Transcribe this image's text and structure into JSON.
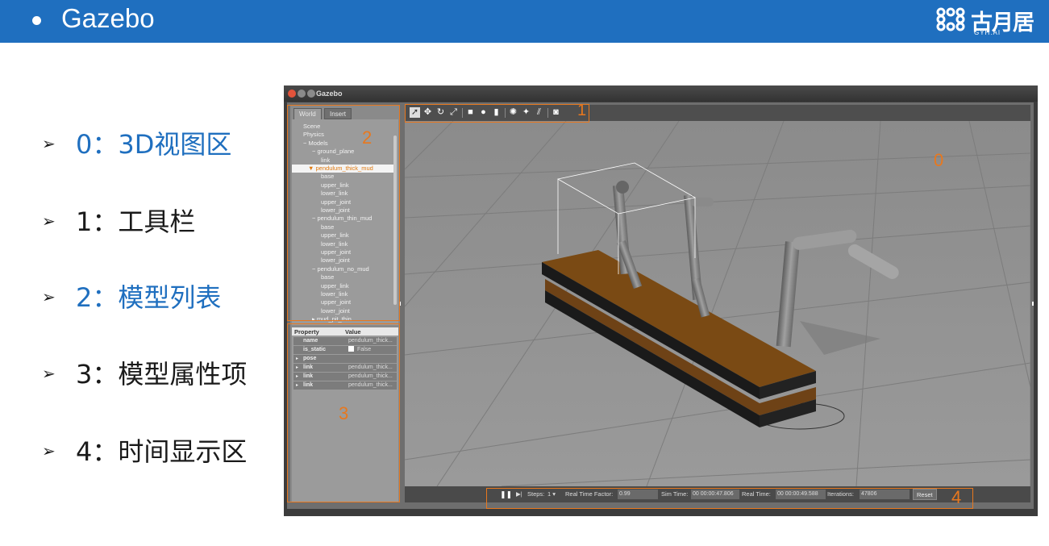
{
  "slide": {
    "title": "Gazebo",
    "logo": {
      "text": "古月居",
      "sub": "GYH.AI"
    },
    "legend": [
      {
        "text": "0：3D视图区",
        "color": "blue"
      },
      {
        "text": "1：工具栏",
        "color": "black"
      },
      {
        "text": "2：模型列表",
        "color": "blue"
      },
      {
        "text": "3：模型属性项",
        "color": "black"
      },
      {
        "text": "4：时间显示区",
        "color": "black"
      }
    ]
  },
  "window": {
    "title": "Gazebo",
    "tabs": [
      "World",
      "Insert"
    ],
    "tree": [
      {
        "label": "Scene",
        "level": 0
      },
      {
        "label": "Physics",
        "level": 0
      },
      {
        "label": "− Models",
        "level": 0
      },
      {
        "label": "− ground_plane",
        "level": 1
      },
      {
        "label": "link",
        "level": 2
      },
      {
        "label": "▼ pendulum_thick_mud",
        "level": 1,
        "selected": true
      },
      {
        "label": "base",
        "level": 2
      },
      {
        "label": "upper_link",
        "level": 2
      },
      {
        "label": "lower_link",
        "level": 2
      },
      {
        "label": "upper_joint",
        "level": 2
      },
      {
        "label": "lower_joint",
        "level": 2
      },
      {
        "label": "− pendulum_thin_mud",
        "level": 1
      },
      {
        "label": "base",
        "level": 2
      },
      {
        "label": "upper_link",
        "level": 2
      },
      {
        "label": "lower_link",
        "level": 2
      },
      {
        "label": "upper_joint",
        "level": 2
      },
      {
        "label": "lower_joint",
        "level": 2
      },
      {
        "label": "− pendulum_no_mud",
        "level": 1
      },
      {
        "label": "base",
        "level": 2
      },
      {
        "label": "upper_link",
        "level": 2
      },
      {
        "label": "lower_link",
        "level": 2
      },
      {
        "label": "upper_joint",
        "level": 2
      },
      {
        "label": "lower_joint",
        "level": 2
      },
      {
        "label": "▸ mud_pit_thin",
        "level": 1
      }
    ],
    "props_header": {
      "property": "Property",
      "value": "Value"
    },
    "props": [
      {
        "key": "name",
        "value": "pendulum_thick..."
      },
      {
        "key": "is_static",
        "value": "False",
        "checkbox": true
      },
      {
        "key": "pose",
        "value": "",
        "expand": true
      },
      {
        "key": "link",
        "value": "pendulum_thick...",
        "expand": true
      },
      {
        "key": "link",
        "value": "pendulum_thick...",
        "expand": true
      },
      {
        "key": "link",
        "value": "pendulum_thick...",
        "expand": true
      }
    ],
    "toolbar_icons": [
      "select-arrow-icon",
      "translate-icon",
      "rotate-icon",
      "scale-icon",
      "box-icon",
      "sphere-icon",
      "cylinder-icon",
      "point-light-icon",
      "spot-light-icon",
      "directional-light-icon",
      "screenshot-icon"
    ],
    "timebar": {
      "pause": "❚❚",
      "step": "▶|",
      "steps_label": "Steps:",
      "steps_value": "1 ▾",
      "rtf_label": "Real Time Factor:",
      "rtf_value": "0.99",
      "sim_label": "Sim Time:",
      "sim_value": "00 00:00:47.806",
      "real_label": "Real Time:",
      "real_value": "00 00:00:49.588",
      "iter_label": "Iterations:",
      "iter_value": "47806",
      "reset": "Reset"
    }
  },
  "annotations": [
    "0",
    "1",
    "2",
    "3",
    "4"
  ],
  "colors": {
    "header": "#1f6fbf",
    "annotation": "#e8781e",
    "wood": "#7a4a14"
  }
}
